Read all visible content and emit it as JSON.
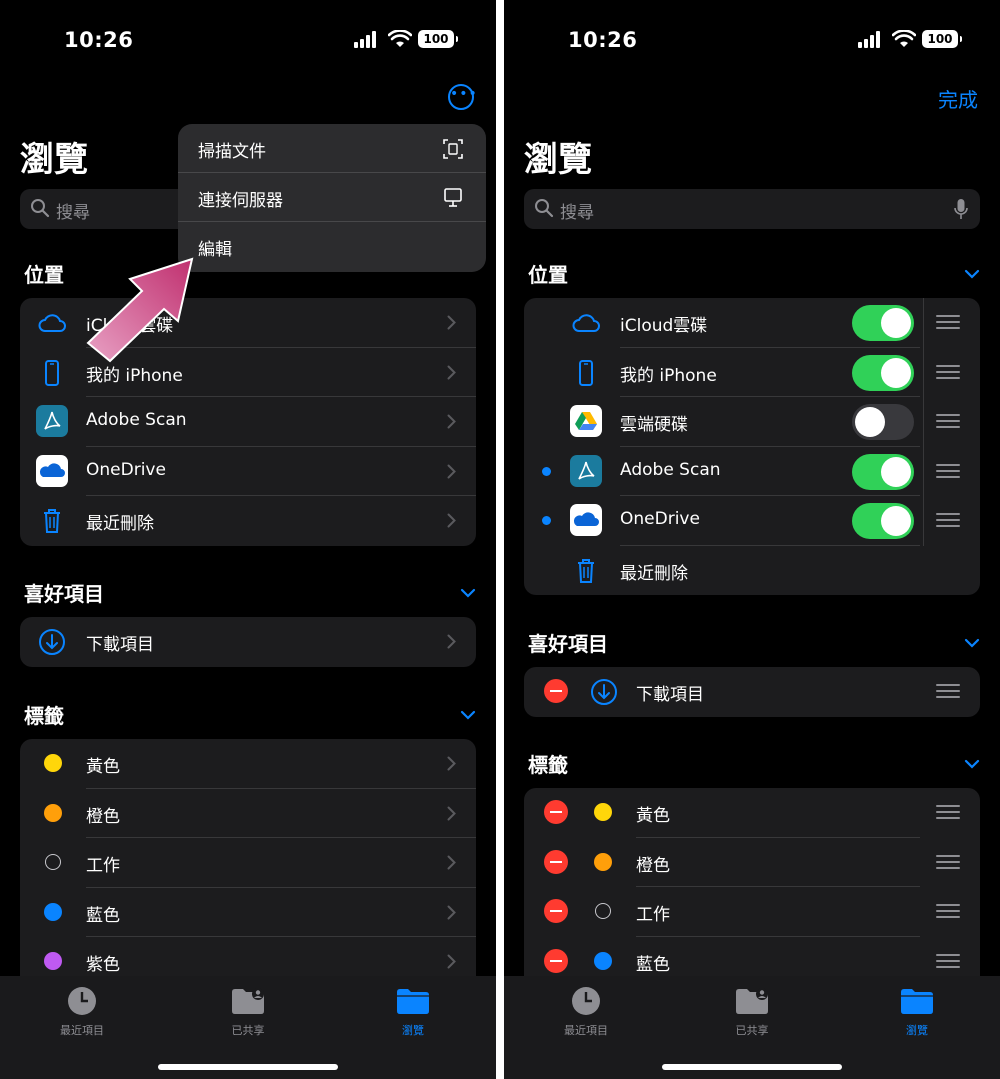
{
  "status": {
    "time": "10:26",
    "battery": "100"
  },
  "title": "瀏覽",
  "search": {
    "placeholder": "搜尋"
  },
  "done_label": "完成",
  "menu": [
    {
      "label": "掃描文件",
      "icon": "scan-document-icon"
    },
    {
      "label": "連接伺服器",
      "icon": "monitor-icon"
    },
    {
      "label": "編輯",
      "icon": ""
    }
  ],
  "sections": {
    "locations": "位置",
    "favorites": "喜好項目",
    "tags": "標籤"
  },
  "locations_left": [
    {
      "label": "iCloud雲碟",
      "icon": "cloud-icon"
    },
    {
      "label": "我的 iPhone",
      "icon": "iphone-icon"
    },
    {
      "label": "Adobe Scan",
      "icon": "adobe-scan-icon"
    },
    {
      "label": "OneDrive",
      "icon": "onedrive-icon"
    },
    {
      "label": "最近刪除",
      "icon": "trash-icon"
    }
  ],
  "locations_right": [
    {
      "label": "iCloud雲碟",
      "icon": "cloud-icon",
      "enabled": true,
      "new": false
    },
    {
      "label": "我的 iPhone",
      "icon": "iphone-icon",
      "enabled": true,
      "new": false
    },
    {
      "label": "雲端硬碟",
      "icon": "google-drive-icon",
      "enabled": false,
      "new": false
    },
    {
      "label": "Adobe Scan",
      "icon": "adobe-scan-icon",
      "enabled": true,
      "new": true
    },
    {
      "label": "OneDrive",
      "icon": "onedrive-icon",
      "enabled": true,
      "new": true
    },
    {
      "label": "最近刪除",
      "icon": "trash-icon"
    }
  ],
  "favorites": [
    {
      "label": "下載項目",
      "icon": "download-icon"
    }
  ],
  "tags_left": [
    {
      "label": "黃色",
      "color": "#ffd60a"
    },
    {
      "label": "橙色",
      "color": "#ff9f0a"
    },
    {
      "label": "工作",
      "color": ""
    },
    {
      "label": "藍色",
      "color": "#0a84ff"
    },
    {
      "label": "紫色",
      "color": "#bf5af2"
    }
  ],
  "tags_right": [
    {
      "label": "黃色",
      "color": "#ffd60a"
    },
    {
      "label": "橙色",
      "color": "#ff9f0a"
    },
    {
      "label": "工作",
      "color": ""
    },
    {
      "label": "藍色",
      "color": "#0a84ff"
    }
  ],
  "tabs": [
    {
      "label": "最近項目",
      "icon": "clock-icon"
    },
    {
      "label": "已共享",
      "icon": "shared-folder-icon"
    },
    {
      "label": "瀏覽",
      "icon": "folder-icon",
      "active": true
    }
  ],
  "colors": {
    "accent": "#0a84ff",
    "toggle_on": "#30d158",
    "delete": "#ff3b30"
  }
}
